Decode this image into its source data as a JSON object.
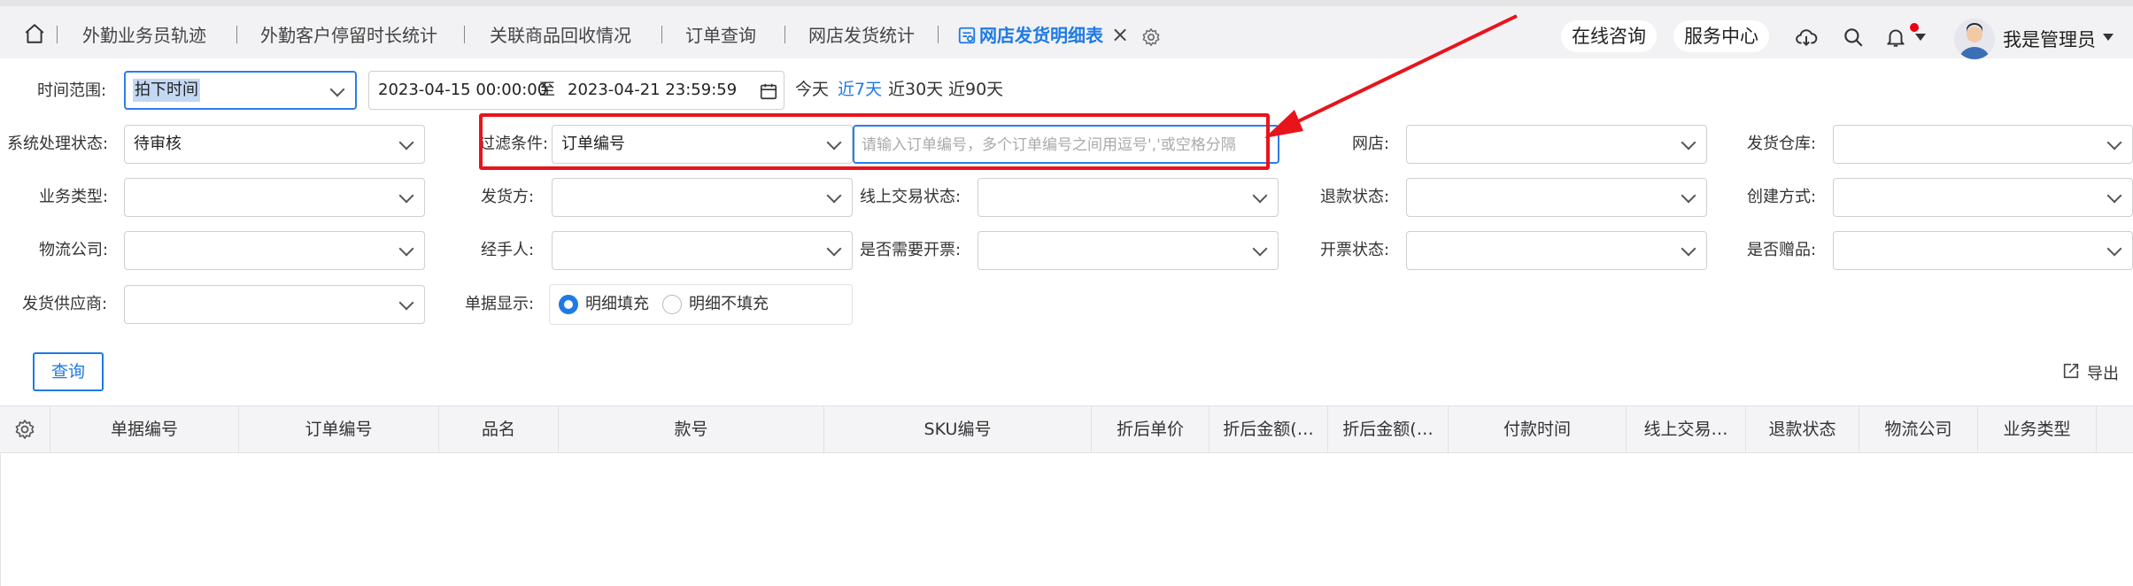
{
  "tabs": [
    {
      "label": "外勤业务员轨迹"
    },
    {
      "label": "外勤客户停留时长统计"
    },
    {
      "label": "关联商品回收情况"
    },
    {
      "label": "订单查询"
    },
    {
      "label": "网店发货统计"
    },
    {
      "label": "网店发货明细表"
    }
  ],
  "header": {
    "online_consult": "在线咨询",
    "service_center": "服务中心",
    "username": "我是管理员"
  },
  "filters": {
    "time_range_label": "时间范围:",
    "time_type_value": "拍下时间",
    "date_start": "2023-04-15 00:00:00",
    "date_to": "至",
    "date_end": "2023-04-21 23:59:59",
    "quick": {
      "today": "今天",
      "d7": "近7天",
      "d30": "近30天",
      "d90": "近90天"
    },
    "sys_status_label": "系统处理状态:",
    "sys_status_value": "待审核",
    "filter_cond_label": "过滤条件:",
    "filter_cond_value": "订单编号",
    "order_input_placeholder": "请输入订单编号，多个订单编号之间用逗号','或空格分隔",
    "shop_label": "网店:",
    "warehouse_label": "发货仓库:",
    "biz_type_label": "业务类型:",
    "shipper_label": "发货方:",
    "online_trade_label": "线上交易状态:",
    "refund_label": "退款状态:",
    "create_method_label": "创建方式:",
    "logistics_label": "物流公司:",
    "handler_label": "经手人:",
    "need_invoice_label": "是否需要开票:",
    "invoice_status_label": "开票状态:",
    "is_gift_label": "是否赠品:",
    "supplier_label": "发货供应商:",
    "doc_display_label": "单据显示:",
    "radio_fill": "明细填充",
    "radio_nofill": "明细不填充"
  },
  "actions": {
    "query": "查询",
    "export": "导出"
  },
  "table": {
    "columns": [
      "单据编号",
      "订单编号",
      "品名",
      "款号",
      "SKU编号",
      "折后单价",
      "折后金额(…",
      "折后金额(…",
      "付款时间",
      "线上交易…",
      "退款状态",
      "物流公司",
      "业务类型"
    ]
  },
  "colors": {
    "accent": "#1e7ae6",
    "highlight_red": "#e8141c",
    "notification_dot": "#e60012"
  }
}
